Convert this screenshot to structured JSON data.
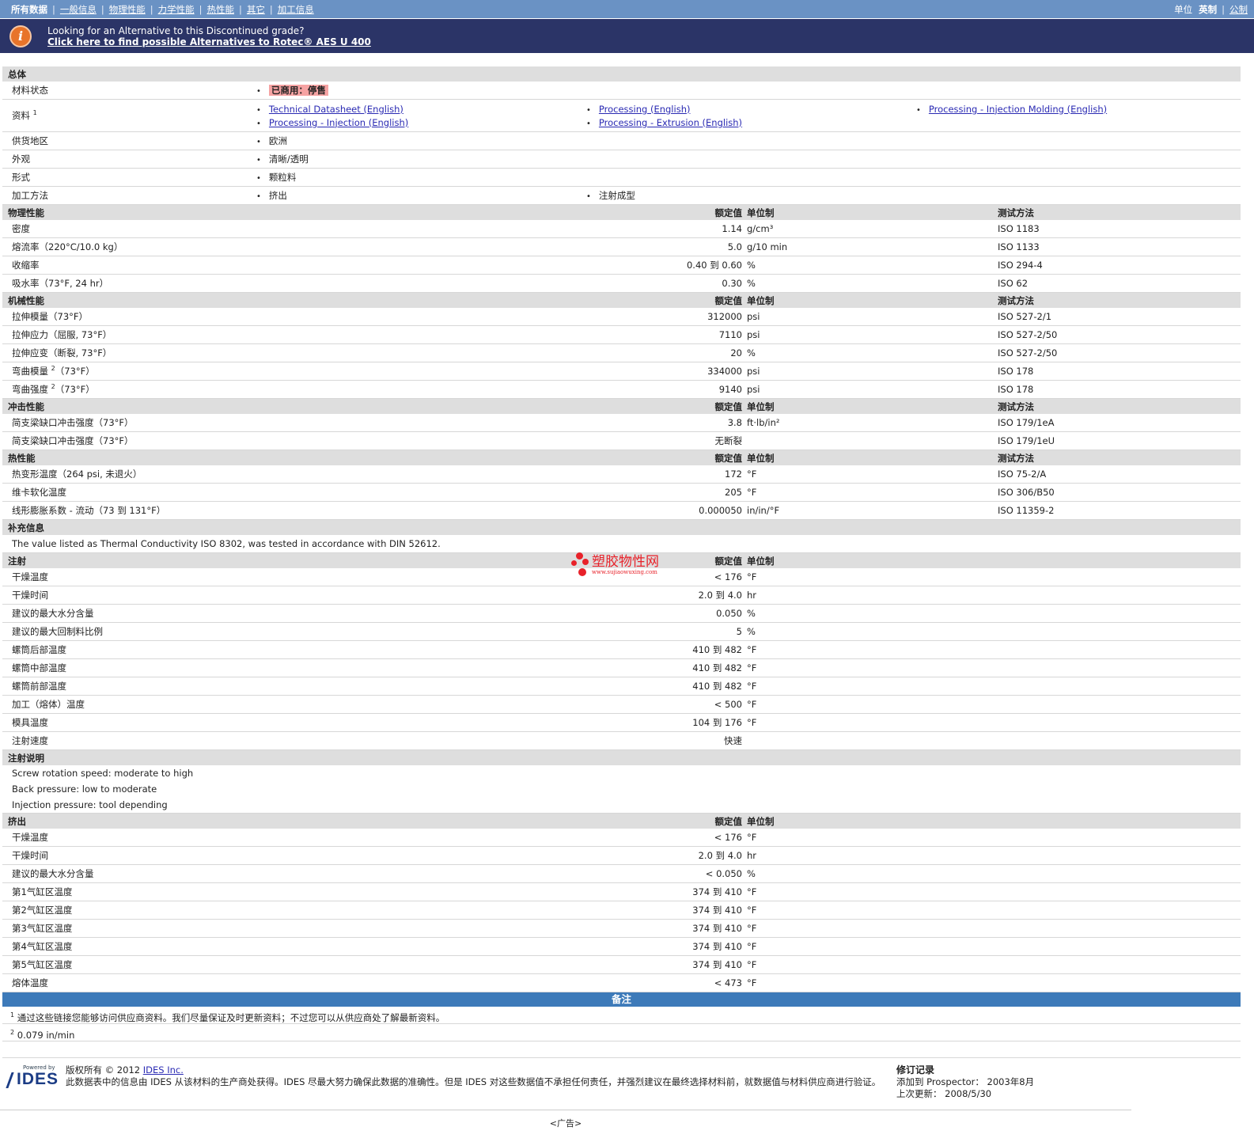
{
  "topnav": {
    "tabs": [
      "所有数据",
      "一般信息",
      "物理性能",
      "力学性能",
      "热性能",
      "其它",
      "加工信息"
    ],
    "unit_label": "单位",
    "unit_english": "英制",
    "unit_metric": "公制"
  },
  "banner": {
    "line1": "Looking for an Alternative to this Discontinued grade?",
    "line2": "Click here to find possible Alternatives to Rotec® AES U 400"
  },
  "headers": {
    "value": "额定值",
    "unit": "单位制",
    "method": "测试方法"
  },
  "general": {
    "title": "总体",
    "status_label": "材料状态",
    "status_value": "已商用：停售",
    "docs_label": "资料",
    "docs_sup": "1",
    "docs": [
      "Technical Datasheet (English)",
      "Processing (English)",
      "Processing - Injection Molding (English)",
      "Processing - Injection (English)",
      "Processing - Extrusion (English)"
    ],
    "region_label": "供货地区",
    "region_value": "欧洲",
    "appearance_label": "外观",
    "appearance_value": "清晰/透明",
    "form_label": "形式",
    "form_value": "颗粒料",
    "process_label": "加工方法",
    "process_values": [
      "挤出",
      "注射成型"
    ]
  },
  "physical": {
    "title": "物理性能",
    "rows": [
      {
        "name": "密度",
        "value": "1.14",
        "unit": "g/cm³",
        "method": "ISO 1183"
      },
      {
        "name": "熔流率（220°C/10.0 kg）",
        "value": "5.0",
        "unit": "g/10 min",
        "method": "ISO 1133"
      },
      {
        "name": "收缩率",
        "value": "0.40 到  0.60",
        "unit": "%",
        "method": "ISO 294-4"
      },
      {
        "name": "吸水率（73°F, 24 hr）",
        "value": "0.30",
        "unit": "%",
        "method": "ISO 62"
      }
    ]
  },
  "mechanical": {
    "title": "机械性能",
    "rows": [
      {
        "name": "拉伸模量（73°F）",
        "sup": "",
        "name2": "",
        "value": "312000",
        "unit": "psi",
        "method": "ISO 527-2/1"
      },
      {
        "name": "拉伸应力（屈服, 73°F）",
        "sup": "",
        "name2": "",
        "value": "7110",
        "unit": "psi",
        "method": "ISO 527-2/50"
      },
      {
        "name": "拉伸应变（断裂, 73°F）",
        "sup": "",
        "name2": "",
        "value": "20",
        "unit": "%",
        "method": "ISO 527-2/50"
      },
      {
        "name": "弯曲模量",
        "sup": "2",
        "name2": "（73°F）",
        "value": "334000",
        "unit": "psi",
        "method": "ISO 178"
      },
      {
        "name": "弯曲强度",
        "sup": "2",
        "name2": "（73°F）",
        "value": "9140",
        "unit": "psi",
        "method": "ISO 178"
      }
    ]
  },
  "impact": {
    "title": "冲击性能",
    "rows": [
      {
        "name": "简支梁缺口冲击强度（73°F）",
        "value": "3.8",
        "unit": "ft·lb/in²",
        "method": "ISO 179/1eA"
      },
      {
        "name": "简支梁缺口冲击强度（73°F）",
        "value": "无断裂",
        "unit": "",
        "method": "ISO 179/1eU"
      }
    ]
  },
  "thermal": {
    "title": "热性能",
    "rows": [
      {
        "name": "热变形温度（264 psi, 未退火）",
        "value": "172",
        "unit": "°F",
        "method": "ISO 75-2/A"
      },
      {
        "name": "维卡软化温度",
        "value": "205",
        "unit": "°F",
        "method": "ISO 306/B50"
      },
      {
        "name": "线形膨胀系数 - 流动（73 到  131°F）",
        "value": "0.000050",
        "unit": "in/in/°F",
        "method": "ISO 11359-2"
      }
    ]
  },
  "supplement": {
    "title": "补充信息",
    "text": "The value listed as Thermal Conductivity ISO 8302, was tested in accordance with DIN 52612."
  },
  "injection": {
    "title": "注射",
    "rows": [
      {
        "name": "干燥温度",
        "value": "< 176",
        "unit": "°F"
      },
      {
        "name": "干燥时间",
        "value": "2.0 到  4.0",
        "unit": "hr"
      },
      {
        "name": "建议的最大水分含量",
        "value": "0.050",
        "unit": "%"
      },
      {
        "name": "建议的最大回制料比例",
        "value": "5",
        "unit": "%"
      },
      {
        "name": "螺筒后部温度",
        "value": "410 到  482",
        "unit": "°F"
      },
      {
        "name": "螺筒中部温度",
        "value": "410 到  482",
        "unit": "°F"
      },
      {
        "name": "螺筒前部温度",
        "value": "410 到  482",
        "unit": "°F"
      },
      {
        "name": "加工（熔体）温度",
        "value": "< 500",
        "unit": "°F"
      },
      {
        "name": "模具温度",
        "value": "104 到  176",
        "unit": "°F"
      },
      {
        "name": "注射速度",
        "value": "快速",
        "unit": ""
      }
    ]
  },
  "injection_notes": {
    "title": "注射说明",
    "lines": [
      "Screw rotation speed: moderate to high",
      "Back pressure: low to moderate",
      "Injection pressure: tool depending"
    ]
  },
  "extrusion": {
    "title": "挤出",
    "rows": [
      {
        "name": "干燥温度",
        "value": "< 176",
        "unit": "°F"
      },
      {
        "name": "干燥时间",
        "value": "2.0 到  4.0",
        "unit": "hr"
      },
      {
        "name": "建议的最大水分含量",
        "value": "< 0.050",
        "unit": "%"
      },
      {
        "name": "第1气缸区温度",
        "value": "374 到  410",
        "unit": "°F"
      },
      {
        "name": "第2气缸区温度",
        "value": "374 到  410",
        "unit": "°F"
      },
      {
        "name": "第3气缸区温度",
        "value": "374 到  410",
        "unit": "°F"
      },
      {
        "name": "第4气缸区温度",
        "value": "374 到  410",
        "unit": "°F"
      },
      {
        "name": "第5气缸区温度",
        "value": "374 到  410",
        "unit": "°F"
      },
      {
        "name": "熔体温度",
        "value": "< 473",
        "unit": "°F"
      }
    ]
  },
  "notes": {
    "title": "备注",
    "items": [
      {
        "sup": "1",
        "text": "通过这些链接您能够访问供应商资料。我们尽量保证及时更新资料；不过您可以从供应商处了解最新资料。"
      },
      {
        "sup": "2",
        "text": "0.079 in/min"
      }
    ]
  },
  "watermark": {
    "text": "塑胶物性网",
    "sub": "www.sujiaowuxing.com"
  },
  "footer": {
    "powered": "Powered by",
    "logo": "IDES",
    "copyright_prefix": "版权所有 © 2012 ",
    "copyright_link": "IDES Inc.",
    "disclaimer": "此数据表中的信息由 IDES 从该材料的生产商处获得。IDES 尽最大努力确保此数据的准确性。但是 IDES 对这些数据值不承担任何责任，并强烈建议在最终选择材料前，就数据值与材料供应商进行验证。",
    "rev_title": "修订记录",
    "added_label": "添加到 Prospector：",
    "added_value": "2003年8月",
    "updated_label": "上次更新：",
    "updated_value": "2008/5/30",
    "ad": "<广告>"
  }
}
